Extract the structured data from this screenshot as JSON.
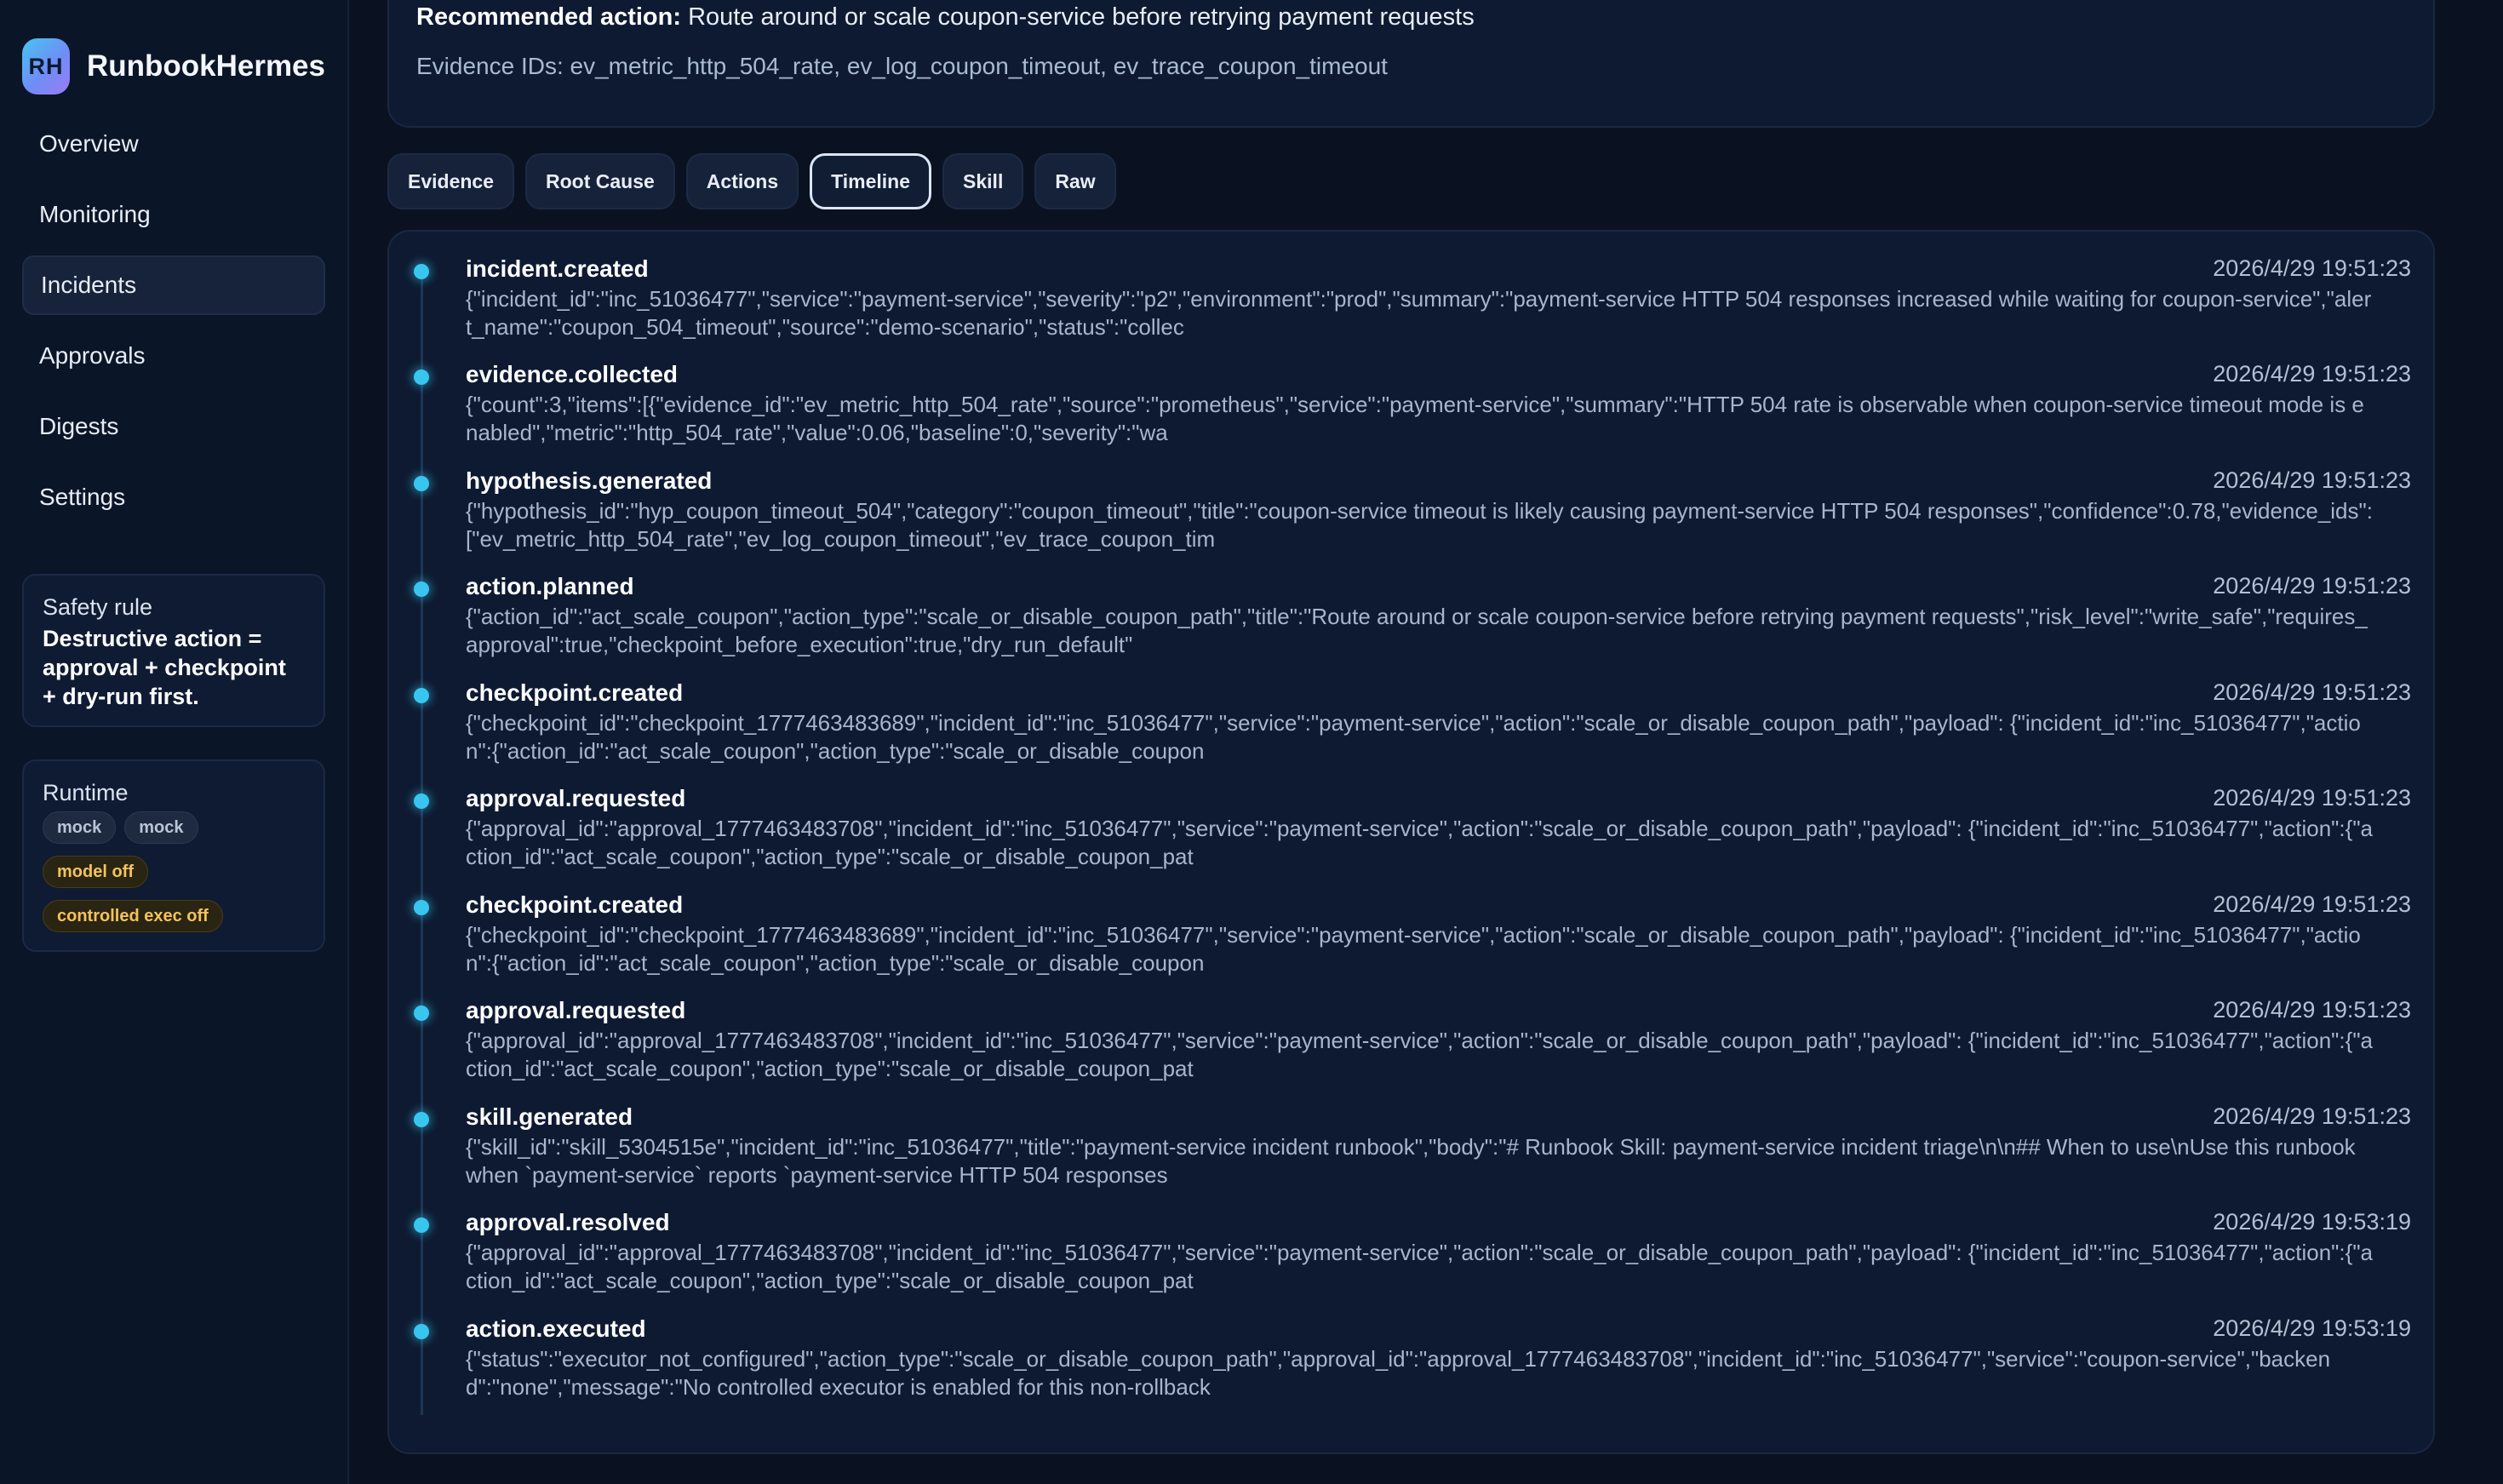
{
  "brand": {
    "logo": "RH",
    "name": "RunbookHermes"
  },
  "nav": [
    {
      "label": "Overview",
      "active": false
    },
    {
      "label": "Monitoring",
      "active": false
    },
    {
      "label": "Incidents",
      "active": true
    },
    {
      "label": "Approvals",
      "active": false
    },
    {
      "label": "Digests",
      "active": false
    },
    {
      "label": "Settings",
      "active": false
    }
  ],
  "safety": {
    "title": "Safety rule",
    "rule": "Destructive action = approval + checkpoint + dry-run first."
  },
  "runtime": {
    "title": "Runtime",
    "pills": [
      "mock",
      "mock",
      "model off",
      "controlled exec off"
    ]
  },
  "summary": {
    "recommended_label": "Recommended action:",
    "recommended_text": "Route around or scale coupon-service before retrying payment requests",
    "evidence_ids": "Evidence IDs: ev_metric_http_504_rate, ev_log_coupon_timeout, ev_trace_coupon_timeout"
  },
  "tabs": [
    {
      "label": "Evidence",
      "active": false
    },
    {
      "label": "Root Cause",
      "active": false
    },
    {
      "label": "Actions",
      "active": false
    },
    {
      "label": "Timeline",
      "active": true
    },
    {
      "label": "Skill",
      "active": false
    },
    {
      "label": "Raw",
      "active": false
    }
  ],
  "events": [
    {
      "name": "incident.created",
      "time": "2026/4/29 19:51:23",
      "payload": "{\"incident_id\":\"inc_51036477\",\"service\":\"payment-service\",\"severity\":\"p2\",\"environment\":\"prod\",\"summary\":\"payment-service HTTP 504 responses increased while waiting for coupon-service\",\"alert_name\":\"coupon_504_timeout\",\"source\":\"demo-scenario\",\"status\":\"collec"
    },
    {
      "name": "evidence.collected",
      "time": "2026/4/29 19:51:23",
      "payload": "{\"count\":3,\"items\":[{\"evidence_id\":\"ev_metric_http_504_rate\",\"source\":\"prometheus\",\"service\":\"payment-service\",\"summary\":\"HTTP 504 rate is observable when coupon-service timeout mode is enabled\",\"metric\":\"http_504_rate\",\"value\":0.06,\"baseline\":0,\"severity\":\"wa"
    },
    {
      "name": "hypothesis.generated",
      "time": "2026/4/29 19:51:23",
      "payload": "{\"hypothesis_id\":\"hyp_coupon_timeout_504\",\"category\":\"coupon_timeout\",\"title\":\"coupon-service timeout is likely causing payment-service HTTP 504 responses\",\"confidence\":0.78,\"evidence_ids\":[\"ev_metric_http_504_rate\",\"ev_log_coupon_timeout\",\"ev_trace_coupon_tim"
    },
    {
      "name": "action.planned",
      "time": "2026/4/29 19:51:23",
      "payload": "{\"action_id\":\"act_scale_coupon\",\"action_type\":\"scale_or_disable_coupon_path\",\"title\":\"Route around or scale coupon-service before retrying payment requests\",\"risk_level\":\"write_safe\",\"requires_approval\":true,\"checkpoint_before_execution\":true,\"dry_run_default\""
    },
    {
      "name": "checkpoint.created",
      "time": "2026/4/29 19:51:23",
      "payload": "{\"checkpoint_id\":\"checkpoint_1777463483689\",\"incident_id\":\"inc_51036477\",\"service\":\"payment-service\",\"action\":\"scale_or_disable_coupon_path\",\"payload\": {\"incident_id\":\"inc_51036477\",\"action\":{\"action_id\":\"act_scale_coupon\",\"action_type\":\"scale_or_disable_coupon"
    },
    {
      "name": "approval.requested",
      "time": "2026/4/29 19:51:23",
      "payload": "{\"approval_id\":\"approval_1777463483708\",\"incident_id\":\"inc_51036477\",\"service\":\"payment-service\",\"action\":\"scale_or_disable_coupon_path\",\"payload\": {\"incident_id\":\"inc_51036477\",\"action\":{\"action_id\":\"act_scale_coupon\",\"action_type\":\"scale_or_disable_coupon_pat"
    },
    {
      "name": "checkpoint.created",
      "time": "2026/4/29 19:51:23",
      "payload": "{\"checkpoint_id\":\"checkpoint_1777463483689\",\"incident_id\":\"inc_51036477\",\"service\":\"payment-service\",\"action\":\"scale_or_disable_coupon_path\",\"payload\": {\"incident_id\":\"inc_51036477\",\"action\":{\"action_id\":\"act_scale_coupon\",\"action_type\":\"scale_or_disable_coupon"
    },
    {
      "name": "approval.requested",
      "time": "2026/4/29 19:51:23",
      "payload": "{\"approval_id\":\"approval_1777463483708\",\"incident_id\":\"inc_51036477\",\"service\":\"payment-service\",\"action\":\"scale_or_disable_coupon_path\",\"payload\": {\"incident_id\":\"inc_51036477\",\"action\":{\"action_id\":\"act_scale_coupon\",\"action_type\":\"scale_or_disable_coupon_pat"
    },
    {
      "name": "skill.generated",
      "time": "2026/4/29 19:51:23",
      "payload": "{\"skill_id\":\"skill_5304515e\",\"incident_id\":\"inc_51036477\",\"title\":\"payment-service incident runbook\",\"body\":\"# Runbook Skill: payment-service incident triage\\n\\n## When to use\\nUse this runbook when `payment-service` reports `payment-service HTTP 504 responses"
    },
    {
      "name": "approval.resolved",
      "time": "2026/4/29 19:53:19",
      "payload": "{\"approval_id\":\"approval_1777463483708\",\"incident_id\":\"inc_51036477\",\"service\":\"payment-service\",\"action\":\"scale_or_disable_coupon_path\",\"payload\": {\"incident_id\":\"inc_51036477\",\"action\":{\"action_id\":\"act_scale_coupon\",\"action_type\":\"scale_or_disable_coupon_pat"
    },
    {
      "name": "action.executed",
      "time": "2026/4/29 19:53:19",
      "payload": "{\"status\":\"executor_not_configured\",\"action_type\":\"scale_or_disable_coupon_path\",\"approval_id\":\"approval_1777463483708\",\"incident_id\":\"inc_51036477\",\"service\":\"coupon-service\",\"backend\":\"none\",\"message\":\"No controlled executor is enabled for this non-rollback"
    }
  ],
  "colors": {
    "accent": "#38c6f0",
    "background": "#0a1222",
    "card": "#0e1a31",
    "amber": "#f4c35a"
  }
}
